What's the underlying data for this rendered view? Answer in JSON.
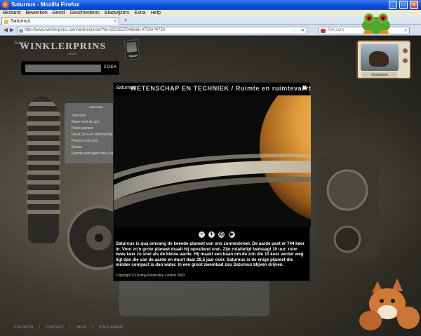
{
  "window": {
    "title": "Saturnus - Mozilla Firefox",
    "minimize": "_",
    "maximize": "□",
    "close": "✕"
  },
  "menu": [
    "Bestand",
    "Bewerken",
    "Beeld",
    "Geschiedenis",
    "Bladwijzers",
    "Extra",
    "Help"
  ],
  "tabs": [
    {
      "label": "Saturnus",
      "close": "x"
    }
  ],
  "new_tab": "+",
  "nav": {
    "back": "◀",
    "forward": "▶",
    "url": "http://www.winklerprins.com/online/junior/?id=102153704&bid=4750#?4750",
    "search_placeholder": "Ask.com",
    "star": "☆",
    "go": "➜"
  },
  "site": {
    "logo_junior": "Junior",
    "logo_brand": "WINKLERPRINS",
    "logo_online": "online",
    "search_button": "ZOEK",
    "bijbaan_label": "bijbaan",
    "tv_label": "Germanen",
    "sidebar_title": "INHOUD",
    "sidebar_items": [
      "Saturnus",
      "Baan rond de zon",
      "Platte planeet",
      "Groot, licht en stormachtig",
      "Planeet met oren",
      "Manen",
      "Ruimtevaartuigen naar Saturnus"
    ],
    "footer": [
      "COLOFON",
      "|",
      "CONTACT",
      "|",
      "HELP",
      "|",
      "DISCLAIMER"
    ]
  },
  "modal": {
    "small_title": "Saturnus",
    "section_title": "WETENSCHAP EN TECHNIEK  /  Ruimte en ruimtevaart",
    "close": "✖",
    "controls": {
      "zoom_out": "–",
      "zoom_in": "+",
      "print": "⎙",
      "next": "▶"
    },
    "caption": "Saturnus is qua omvang de tweede planeet van ons zonnestelsel. De aarde past er 744 keer in. Voor zo'n grote planeet draait hij opvallend snel. Zijn rotatietijd bedraagt 10 uur; ruim twee keer zo snel als de kleine aarde. Hij maakt een baan om de zon die 10 keer verder weg ligt dan die van de aarde en duurt daar 29,5 jaar over. Saturnus is de enige planeet die minder compact is dan water. In een groot zwembad zou Saturnus blijven drijven.",
    "copyright": "Copyright © Dorling Kindersley Limited 2003"
  }
}
